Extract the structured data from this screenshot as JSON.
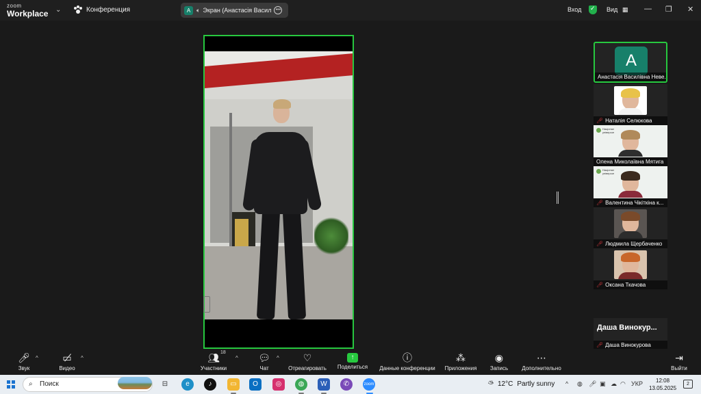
{
  "app": {
    "logo_top": "zoom",
    "logo_bottom": "Workplace",
    "meeting_label": "Конференция"
  },
  "screen_share": {
    "avatar_letter": "A",
    "label": "Экран (Анастасія Василівн"
  },
  "topbar": {
    "signin": "Вход",
    "view": "Вид",
    "minimize": "—",
    "maximize": "❐",
    "close": "✕"
  },
  "gallery": {
    "tiles": [
      {
        "name": "Анастасія Василівна Неве...",
        "avatar_letter": "A",
        "muted": false,
        "kind": "avatar"
      },
      {
        "name": "Наталія Селюкова",
        "muted": true,
        "kind": "face",
        "bg": "#ffffff",
        "hair": "#e8c24a",
        "body": "#ffffff"
      },
      {
        "name": "Олена Миколаївна Мятига",
        "muted": false,
        "kind": "wide"
      },
      {
        "name": "Валентина Чікіткіна к...",
        "muted": true,
        "kind": "wide"
      },
      {
        "name": "Людмила Щербаченко",
        "muted": true,
        "kind": "face",
        "bg": "#5a5552",
        "hair": "#7a4a2a",
        "body": "#2c2c2c"
      },
      {
        "name": "Оксана Ткачова",
        "muted": true,
        "kind": "face",
        "bg": "#d9c3ad",
        "hair": "#c8662a",
        "body": "#7a2a2a"
      },
      {
        "name": "Даша Винокурова",
        "big_label": "Даша Винокур...",
        "muted": true,
        "kind": "text"
      }
    ],
    "wide_header": "Національний фармацевтичний університет"
  },
  "toolbar": {
    "audio": "Звук",
    "video": "Видео",
    "participants": "Участники",
    "participants_count": "18",
    "chat": "Чат",
    "react": "Отреагировать",
    "share": "Поделиться",
    "info": "Данные конференции",
    "apps": "Приложения",
    "record": "Запись",
    "more": "Дополнительно",
    "leave": "Выйти"
  },
  "taskbar": {
    "search_placeholder": "Поиск",
    "weather_temp": "12°C",
    "weather_text": "Partly sunny",
    "lang": "УКР",
    "time": "12:08",
    "date": "13.05.2025",
    "notifications": "2"
  },
  "colors": {
    "accent": "#27c93f",
    "avatar": "#17806a",
    "mute": "#e0393e"
  }
}
